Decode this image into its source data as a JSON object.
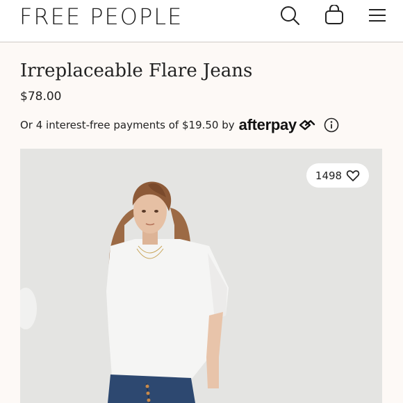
{
  "header": {
    "brand": "FREE PEOPLE",
    "icons": [
      "search-icon",
      "shopping-bag-icon",
      "menu-icon"
    ]
  },
  "product": {
    "title": "Irreplaceable Flare Jeans",
    "price": "$78.00",
    "installments_text": "Or 4 interest-free payments of $19.50 by",
    "afterpay_brand": "afterpay",
    "like_count": "1498"
  },
  "colors": {
    "background": "#fdf9f6",
    "header_bg": "#ffffff",
    "text": "#222222",
    "divider": "#cfcac5"
  }
}
